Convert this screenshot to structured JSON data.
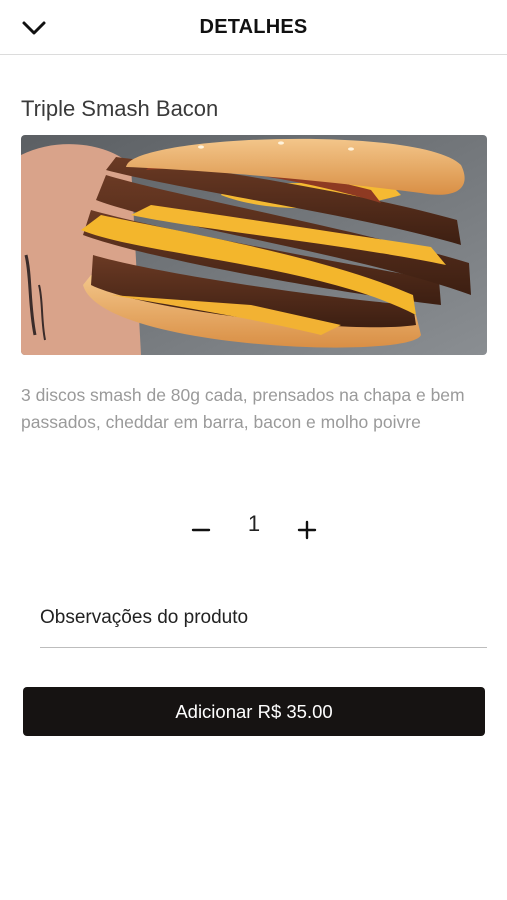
{
  "header": {
    "back_icon": "chevron-down-icon",
    "title": "DETALHES"
  },
  "product": {
    "name": "Triple Smash Bacon",
    "image_alt": "Triple Smash Bacon burger",
    "description": "3 discos smash de 80g cada, prensados na chapa e bem passados, cheddar em barra, bacon e molho poivre"
  },
  "quantity": {
    "minus_icon": "minus-icon",
    "value": "1",
    "plus_icon": "plus-icon"
  },
  "notes": {
    "placeholder": "Observações do produto",
    "value": ""
  },
  "add_button": {
    "label": "Adicionar R$ 35.00"
  },
  "colors": {
    "button_bg": "#161312",
    "description_text": "#9a9a9a",
    "divider": "#dcdcdc"
  }
}
